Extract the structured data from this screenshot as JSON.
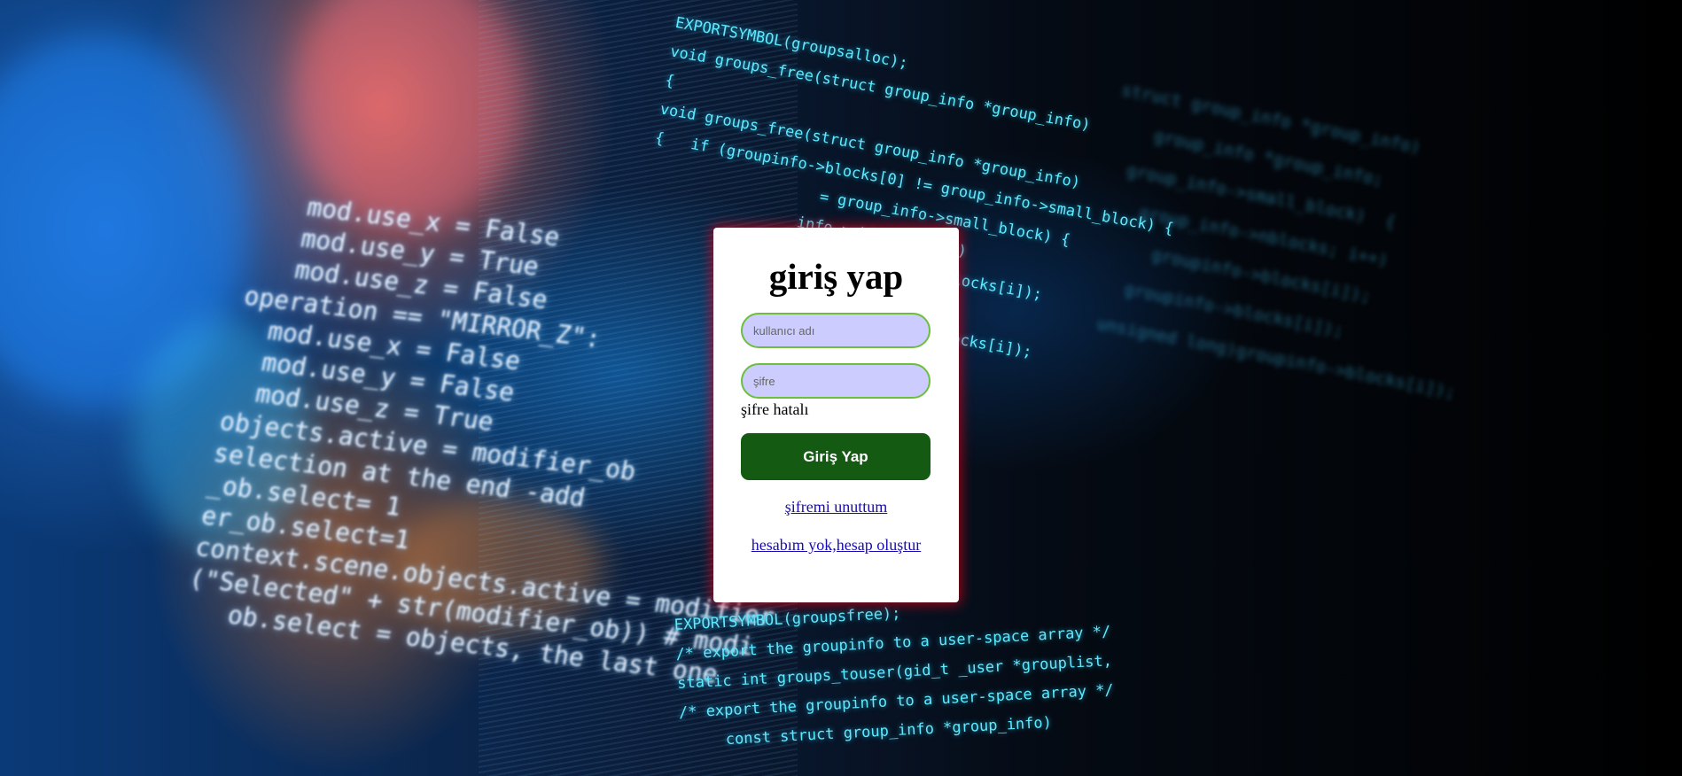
{
  "login": {
    "title": "giriş yap",
    "username_placeholder": "kullanıcı adı",
    "password_placeholder": "şifre",
    "error_message": "şifre hatalı",
    "submit_label": "Giriş Yap",
    "forgot_password_link": "şifremi unuttum",
    "register_link": "hesabım yok,hesap oluştur"
  },
  "colors": {
    "button": "#145a13",
    "field_fill": "#ccccff",
    "field_border": "#6cbf3b",
    "link": "#1a0dab",
    "card_glow": "#dc0014"
  }
}
